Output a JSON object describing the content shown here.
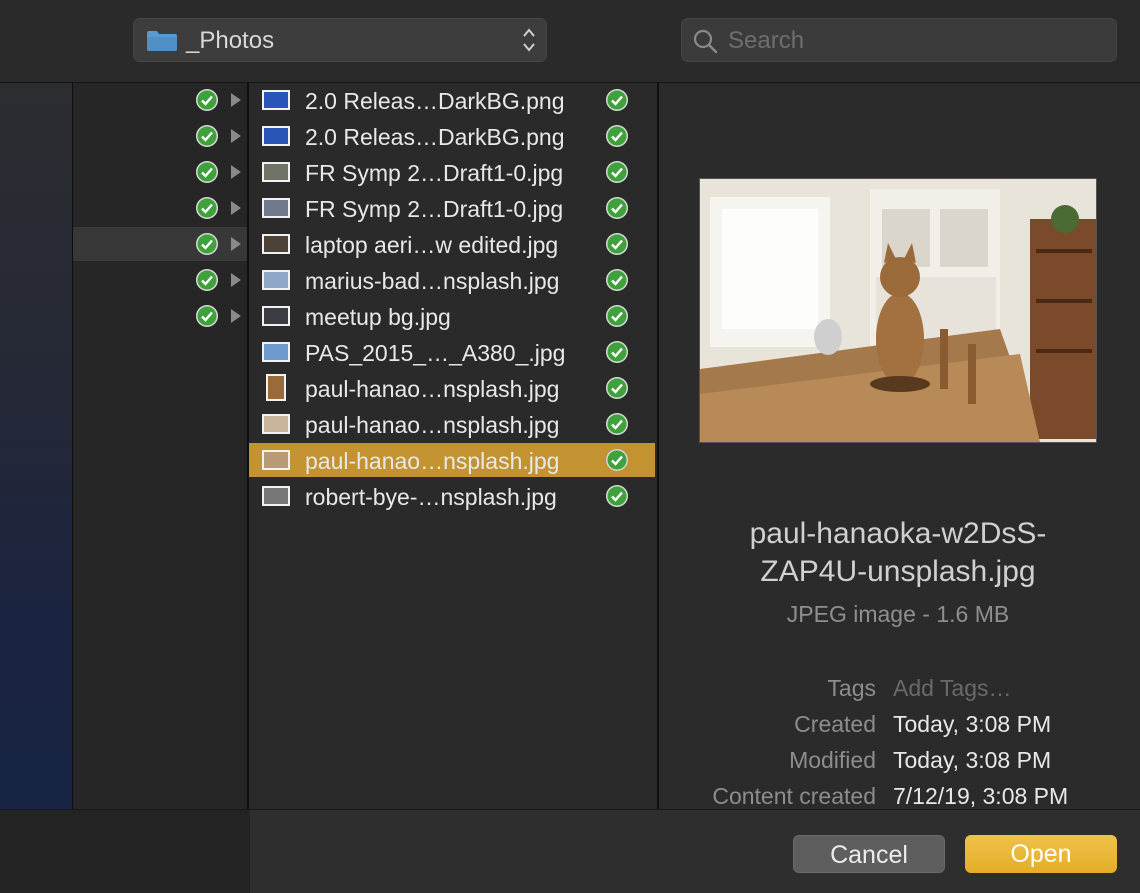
{
  "toolbar": {
    "folder_label": "_Photos",
    "search_placeholder": "Search"
  },
  "files": [
    {
      "name": "2.0 Releas…DarkBG.png"
    },
    {
      "name": "2.0 Releas…DarkBG.png"
    },
    {
      "name": "FR Symp 2…Draft1-0.jpg"
    },
    {
      "name": "FR Symp 2…Draft1-0.jpg"
    },
    {
      "name": "laptop aeri…w edited.jpg"
    },
    {
      "name": "marius-bad…nsplash.jpg"
    },
    {
      "name": "meetup bg.jpg"
    },
    {
      "name": "PAS_2015_…_A380_.jpg"
    },
    {
      "name": "paul-hanao…nsplash.jpg"
    },
    {
      "name": "paul-hanao…nsplash.jpg"
    },
    {
      "name": "paul-hanao…nsplash.jpg",
      "selected": true
    },
    {
      "name": "robert-bye-…nsplash.jpg"
    }
  ],
  "preview": {
    "name_line1": "paul-hanaoka-w2DsS-",
    "name_line2": "ZAP4U-unsplash.jpg",
    "kind": "JPEG image - 1.6 MB",
    "meta": [
      {
        "label": "Tags",
        "value": "Add Tags…"
      },
      {
        "label": "Created",
        "value": "Today, 3:08 PM"
      },
      {
        "label": "Modified",
        "value": "Today, 3:08 PM"
      },
      {
        "label": "Content created",
        "value": "7/12/19, 3:08 PM"
      }
    ]
  },
  "footer": {
    "cancel_label": "Cancel",
    "open_label": "Open"
  },
  "colors": {
    "selection": "#c39331",
    "open_button": "#e8b232",
    "synced_check": "#3ea13c"
  }
}
